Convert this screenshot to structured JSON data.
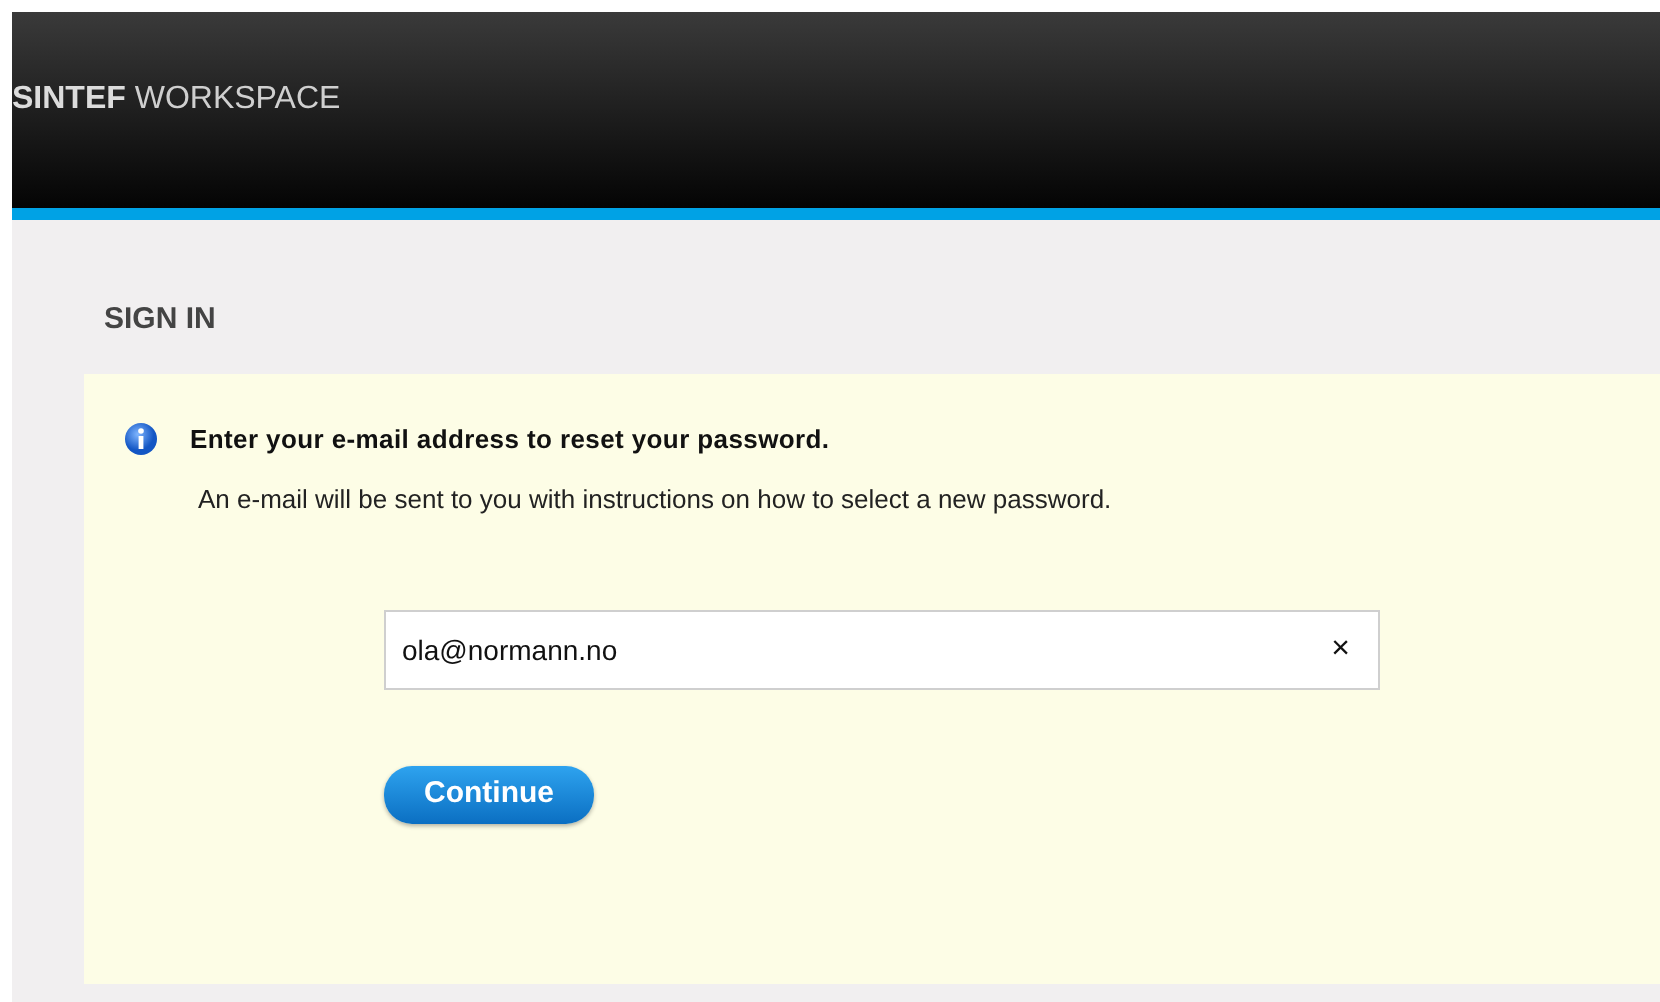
{
  "header": {
    "logo": "**SINTEF** WORKSPACE"
  },
  "section_title": "SIGN IN",
  "message": {
    "heading": "Enter your e-mail address to reset your password.",
    "text": "An e-mail will be sent to you with instructions on how to select a new password."
  },
  "email_field": {
    "value": "ola@normann.no",
    "clear": "×"
  },
  "buttons": [
    "Continue"
  ]
}
